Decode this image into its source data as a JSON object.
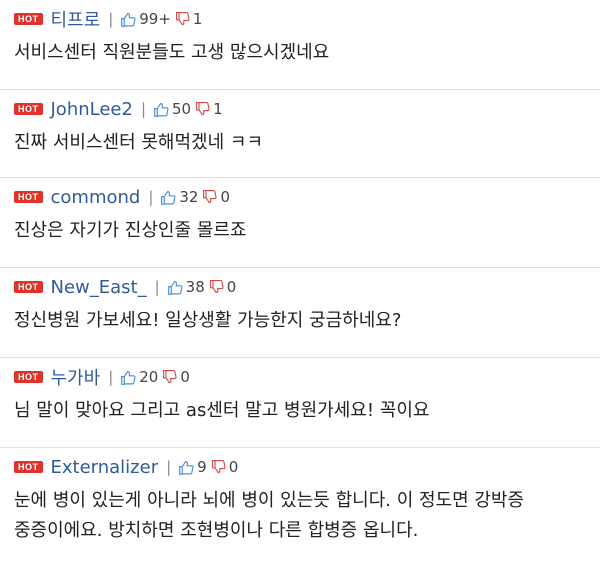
{
  "colors": {
    "hot_badge": "#e0322a",
    "author": "#2f5a9e",
    "icon_stroke": "#4a8fd9",
    "icon_stroke_down": "#d04a4a"
  },
  "comments": [
    {
      "badge": "HOT",
      "author": "티프로",
      "likes": "99+",
      "dislikes": "1",
      "lines": [
        "서비스센터 직원분들도 고생 많으시겠네요"
      ]
    },
    {
      "badge": "HOT",
      "author": "JohnLee2",
      "likes": "50",
      "dislikes": "1",
      "lines": [
        "진짜 서비스센터 못해먹겠네 ㅋㅋ"
      ]
    },
    {
      "badge": "HOT",
      "author": "commond",
      "likes": "32",
      "dislikes": "0",
      "lines": [
        "진상은 자기가 진상인줄 몰르죠"
      ]
    },
    {
      "badge": "HOT",
      "author": "New_East_",
      "likes": "38",
      "dislikes": "0",
      "lines": [
        "정신병원 가보세요! 일상생활 가능한지 궁금하네요?"
      ]
    },
    {
      "badge": "HOT",
      "author": "누가바",
      "likes": "20",
      "dislikes": "0",
      "lines": [
        "님 말이 맞아요 그리고 as센터 말고 병원가세요! 꼭이요"
      ]
    },
    {
      "badge": "HOT",
      "author": "Externalizer",
      "likes": "9",
      "dislikes": "0",
      "lines": [
        "눈에 병이 있는게 아니라 뇌에 병이 있는듯 합니다. 이 정도면 강박증",
        "중증이에요. 방치하면 조현병이나 다른 합병증 옵니다."
      ]
    }
  ]
}
